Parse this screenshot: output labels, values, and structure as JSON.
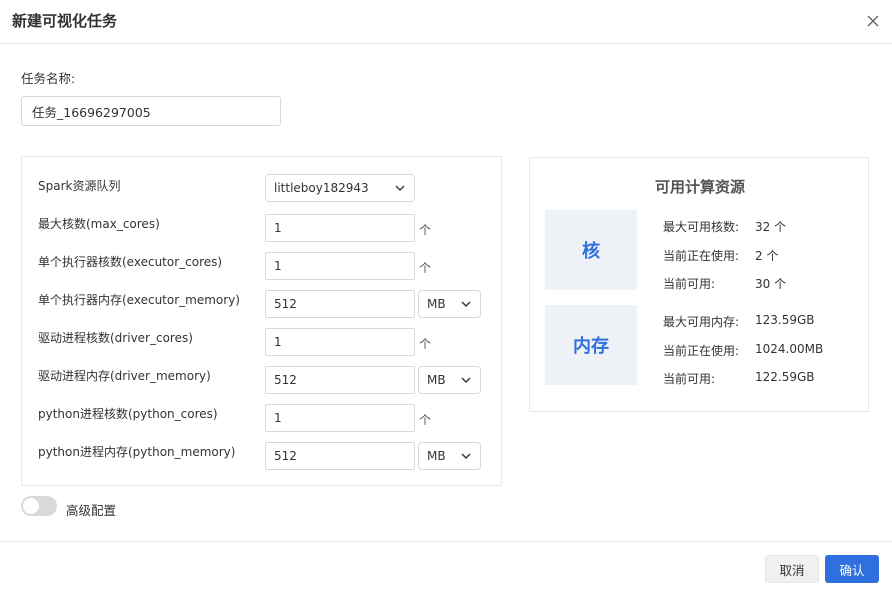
{
  "dialog": {
    "title": "新建可视化任务",
    "close_icon": "close-icon"
  },
  "task_name": {
    "label": "任务名称:",
    "value": "任务_16696297005"
  },
  "config": {
    "queue": {
      "label": "Spark资源队列",
      "value": "littleboy182943"
    },
    "max_cores": {
      "label": "最大核数(max_cores)",
      "value": "1",
      "unit": "个"
    },
    "executor_cores": {
      "label": "单个执行器核数(executor_cores)",
      "value": "1",
      "unit": "个"
    },
    "executor_memory": {
      "label": "单个执行器内存(executor_memory)",
      "value": "512",
      "unit": "MB"
    },
    "driver_cores": {
      "label": "驱动进程核数(driver_cores)",
      "value": "1",
      "unit": "个"
    },
    "driver_memory": {
      "label": "驱动进程内存(driver_memory)",
      "value": "512",
      "unit": "MB"
    },
    "python_cores": {
      "label": "python进程核数(python_cores)",
      "value": "1",
      "unit": "个"
    },
    "python_memory": {
      "label": "python进程内存(python_memory)",
      "value": "512",
      "unit": "MB"
    }
  },
  "resources": {
    "title": "可用计算资源",
    "cores": {
      "label": "核",
      "max_key": "最大可用核数:",
      "max_val": "32 个",
      "used_key": "当前正在使用:",
      "used_val": "2 个",
      "avail_key": "当前可用:",
      "avail_val": "30 个"
    },
    "memory": {
      "label": "内存",
      "max_key": "最大可用内存:",
      "max_val": "123.59GB",
      "used_key": "当前正在使用:",
      "used_val": "1024.00MB",
      "avail_key": "当前可用:",
      "avail_val": "122.59GB"
    }
  },
  "advanced": {
    "label": "高级配置",
    "enabled": false
  },
  "footer": {
    "cancel_label": "取消",
    "ok_label": "确认"
  },
  "colors": {
    "primary": "#2f6fde",
    "res_box_bg": "#eef1f5",
    "border": "#e8e8e8"
  }
}
